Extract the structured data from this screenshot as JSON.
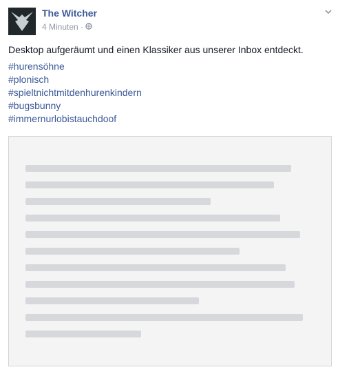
{
  "page": {
    "name": "The Witcher"
  },
  "post": {
    "timestamp": "4 Minuten",
    "separator": "·",
    "audience_icon": "globe-icon",
    "caption": "Desktop aufgeräumt und einen Klassiker aus unserer Inbox entdeckt.",
    "hashtags": [
      "#hurensöhne",
      "#plonisch",
      "#spieltnichtmitdenhurenkindern",
      "#bugsbunny",
      "#immernurlobistauchdoof"
    ]
  },
  "colors": {
    "link": "#3b5998",
    "meta": "#9197a3",
    "text": "#141823"
  }
}
